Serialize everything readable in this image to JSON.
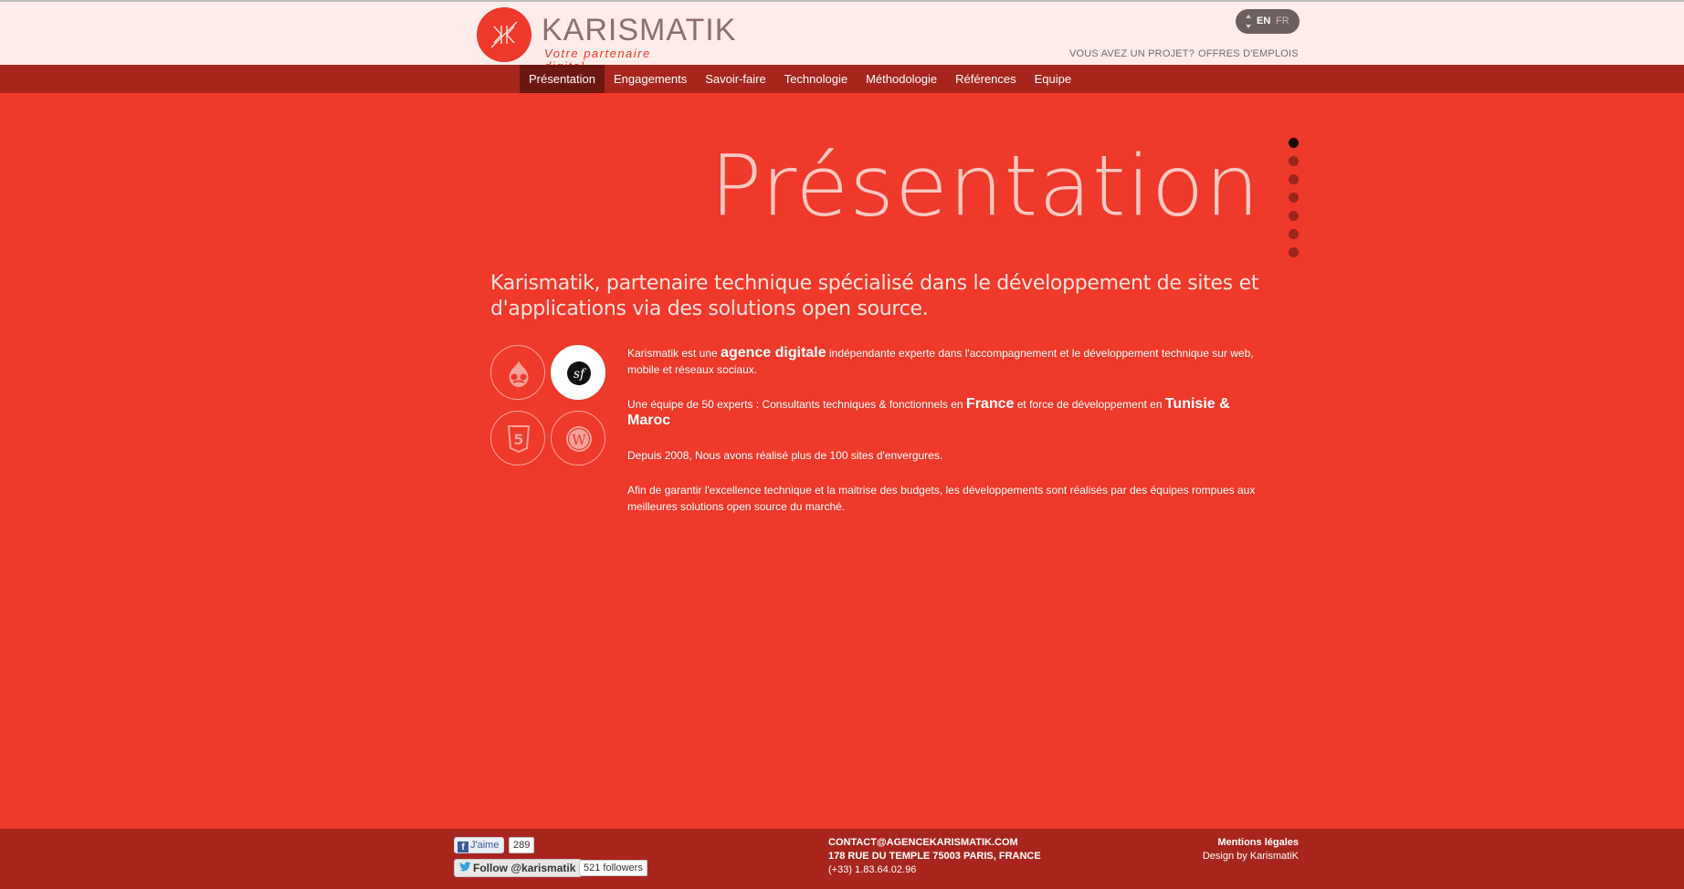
{
  "header": {
    "logo": {
      "word": "KARISMATIK",
      "tagline": "Votre partenaire digital",
      "icon": "karismatik-logo-icon"
    },
    "lang": {
      "current": "EN",
      "other": "FR"
    },
    "links": {
      "projet": "VOUS AVEZ UN PROJET?",
      "emplois": "OFFRES D'EMPLOIS"
    }
  },
  "nav": {
    "items": [
      {
        "label": "Présentation",
        "active": true
      },
      {
        "label": "Engagements"
      },
      {
        "label": "Savoir-faire"
      },
      {
        "label": "Technologie"
      },
      {
        "label": "Méthodologie"
      },
      {
        "label": "Références"
      },
      {
        "label": "Equipe"
      }
    ]
  },
  "main": {
    "title": "Présentation",
    "subtitle": "Karismatik, partenaire technique spécialisé dans le développement de sites et d'applications via des solutions open source.",
    "p1": {
      "a": "Karismatik est une ",
      "b": "agence digitale",
      "c": " indépendante experte dans l'accompagnement et le développement technique sur web, mobile et réseaux sociaux."
    },
    "p2": {
      "a": "Une équipe de 50 experts : Consultants techniques & fonctionnels en ",
      "b": "France",
      "c": " et force de développement en ",
      "d": "Tunisie",
      "e": " & ",
      "f": "Maroc"
    },
    "p3": "Depuis 2008, Nous avons réalisé plus de 100 sites d'envergures.",
    "p4": "Afin de garantir l'excellence technique et la maitrise des budgets, les développements sont réalisés par des équipes rompues aux meilleures solutions open source du marché.",
    "tech_icons": [
      "drupal-icon",
      "symfony-icon",
      "html5-icon",
      "wordpress-icon"
    ],
    "section_dots": {
      "count": 7,
      "active_index": 0
    }
  },
  "footer": {
    "facebook": {
      "label": "J'aime",
      "count": "289"
    },
    "twitter": {
      "label": "Follow @karismatik",
      "count": "521 followers"
    },
    "contact": {
      "email": "CONTACT@AGENCEKARISMATIK.COM",
      "address": "178 RUE DU TEMPLE 75003 PARIS, FRANCE",
      "phone": "(+33) 1.83.64.02.96"
    },
    "legal": {
      "mentions": "Mentions légales",
      "design": "Design by KarismatiK"
    }
  },
  "colors": {
    "background": "#ef392b",
    "header_bg": "#fdecea",
    "nav_bg": "#a7251d",
    "nav_active": "#6d1711",
    "footer_bg": "#a7251d"
  }
}
